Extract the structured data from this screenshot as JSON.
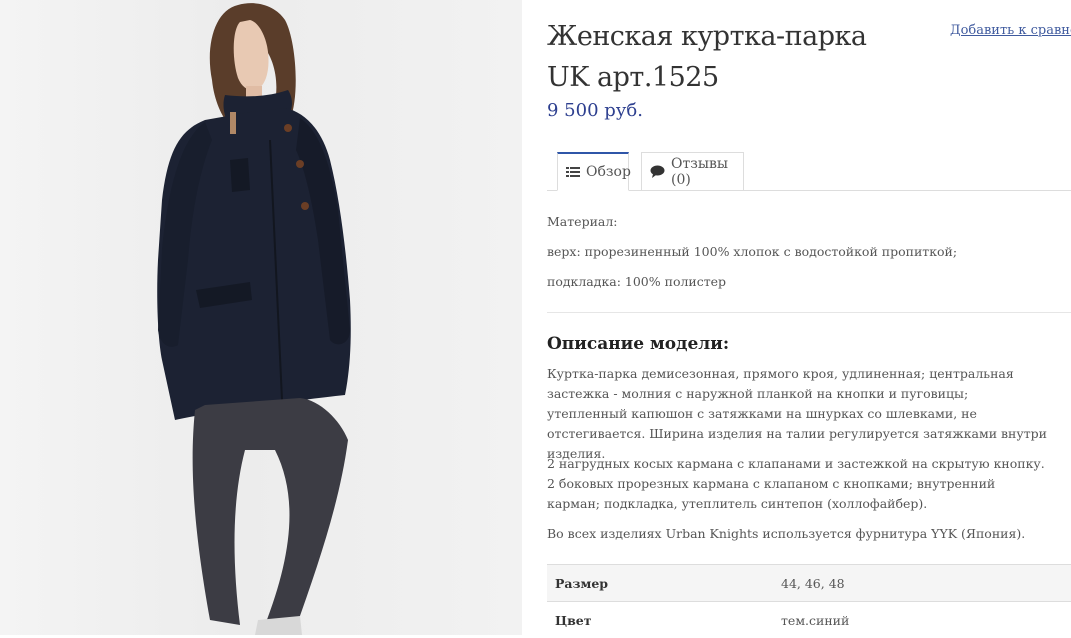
{
  "product": {
    "title": "Женская куртка-парка UK арт.1525",
    "compare_link": "Добавить к сравнению",
    "price": "9 500 руб."
  },
  "tabs": [
    {
      "label": "Обзор",
      "icon": "list-icon",
      "active": true
    },
    {
      "label": "Отзывы (0)",
      "icon": "comment-icon",
      "active": false
    }
  ],
  "material": {
    "label": "Материал:",
    "top": "верх: прорезиненный 100% хлопок с водостойкой пропиткой;",
    "lining": "подкладка: 100% полистер"
  },
  "description": {
    "heading": "Описание модели:",
    "paragraphs": [
      "Куртка-парка демисезонная, прямого кроя, удлиненная; центральная застежка - молния с наружной планкой на кнопки и пуговицы; утепленный капюшон с затяжками на шнурках со шлевками, не отстегивается. Ширина изделия на талии регулируется затяжками внутри изделия.",
      "2 нагрудных косых кармана с клапанами и застежкой на скрытую кнопку. 2 боковых прорезных кармана с клапаном с кнопками; внутренний карман; подкладка, утеплитель синтепон (холлофайбер).",
      "Во всех изделиях Urban Knights используется фурнитура YYK (Япония)."
    ]
  },
  "specs": [
    {
      "key": "Размер",
      "value": "44, 46, 48"
    },
    {
      "key": "Цвет",
      "value": "тем.синий"
    }
  ],
  "colors": {
    "price": "#2d3f8f",
    "link": "#3f5a9e",
    "tab_active_border": "#2f56a8",
    "jacket": "#1c2233",
    "jeans": "#3c3c44"
  }
}
